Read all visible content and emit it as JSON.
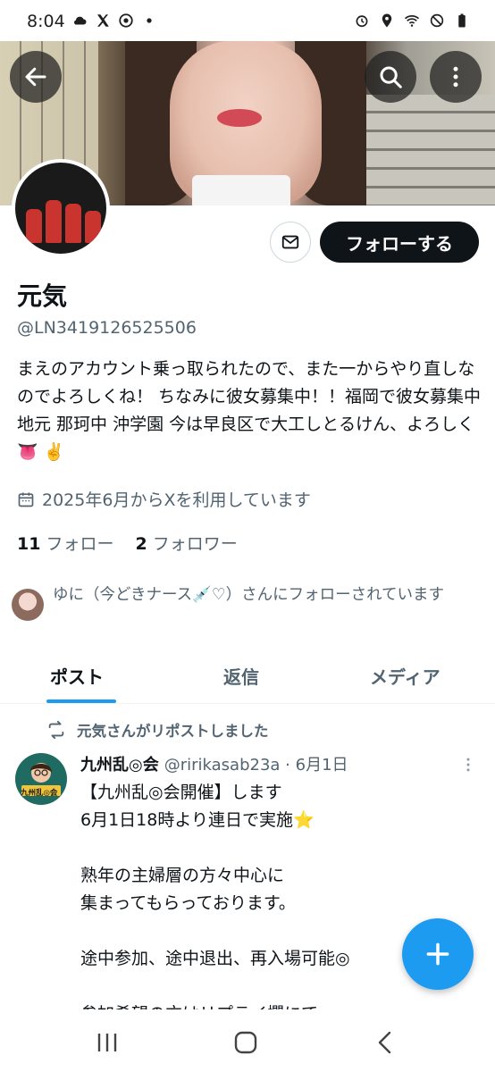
{
  "status_bar": {
    "time": "8:04",
    "left_icons": [
      "cloud-icon",
      "x-logo-icon",
      "chrome-icon",
      "dot-icon"
    ],
    "right_icons": [
      "alarm-icon",
      "location-icon",
      "wifi-icon",
      "do-not-disturb-icon",
      "battery-icon"
    ]
  },
  "profile": {
    "display_name": "元気",
    "handle": "@LN3419126525506",
    "bio": "まえのアカウント乗っ取られたので、また一からやり直しなのでよろしくね！ ちなみに彼女募集中！！福岡で彼女募集中 地元 那珂中 沖学園 今は早良区で大工しとるけん、よろしく👅 ✌️",
    "joined": "2025年6月からXを利用しています",
    "following_count": "11",
    "following_label": "フォロー",
    "followers_count": "2",
    "followers_label": "フォロワー",
    "followed_by": "ゆに（今どきナース💉♡）さんにフォローされています"
  },
  "actions": {
    "follow_label": "フォローする"
  },
  "tabs": [
    {
      "label": "ポスト",
      "active": true
    },
    {
      "label": "返信",
      "active": false
    },
    {
      "label": "メディア",
      "active": false
    }
  ],
  "post": {
    "repost_label": "元気さんがリポストしました",
    "author_name": "九州乱◎会",
    "author_handle": "@ririkasab23a",
    "separator": "·",
    "date": "6月1日",
    "avatar_label": "九州乱◎会",
    "body": "【九州乱◎会開催】します\n6月1日18時より連日で実施⭐\n\n熟年の主婦層の方々中心に\n集まってもらっております。\n\n途中参加、途中退出、再入場可能◎\n\n参加希望の方はリプライ欄にて"
  },
  "colors": {
    "accent": "#1d9bf0",
    "text_primary": "#0f1419",
    "text_secondary": "#536471",
    "follow_button_bg": "#0f1419"
  }
}
